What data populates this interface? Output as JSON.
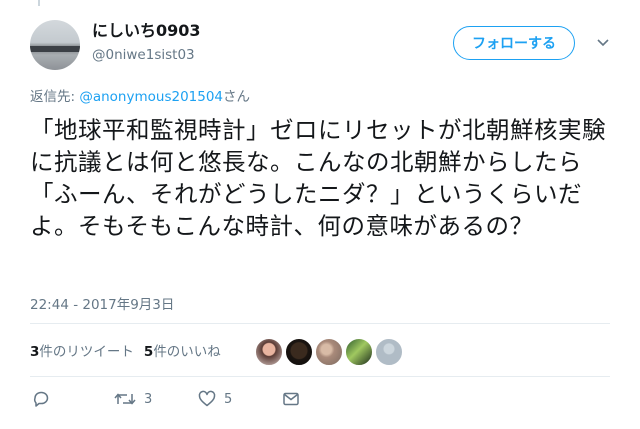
{
  "tweet": {
    "display_name": "にしいち0903",
    "handle": "@0niwe1sist03",
    "follow_label": "フォローする",
    "reply_prefix": "返信先: ",
    "reply_mention": "@anonymous201504",
    "reply_suffix": "さん",
    "text": "「地球平和監視時計」ゼロにリセットが北朝鮮核実験に抗議とは何と悠長な。こんなの北朝鮮からしたら「ふーん、それがどうしたニダ？」というくらいだよ。そもそもこんな時計、何の意味があるの？",
    "timestamp": "22:44 - 2017年9月3日",
    "retweet_count": "3",
    "retweet_label": "件のリツイート",
    "like_count": "5",
    "like_label": "件のいいね",
    "action_retweet_count": "3",
    "action_like_count": "5"
  },
  "icons": [
    "reply-icon",
    "retweet-icon",
    "like-icon",
    "message-icon",
    "caret-down-icon"
  ],
  "colors": {
    "accent": "#1da1f2",
    "secondary_text": "#657786",
    "primary_text": "#14171a",
    "divider": "#e6ecf0"
  }
}
